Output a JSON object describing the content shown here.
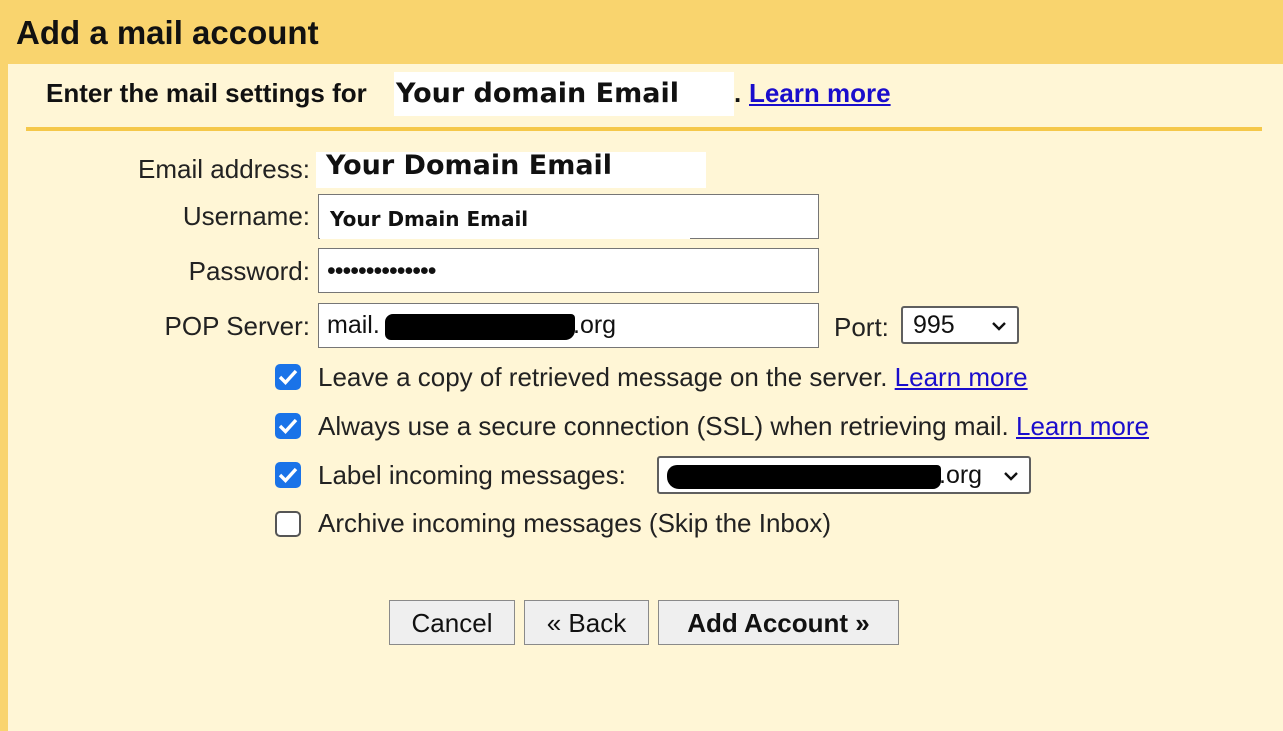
{
  "dialog": {
    "title": "Add a mail account"
  },
  "header": {
    "prefix": "Enter the mail settings for",
    "domain": "Your domain Email",
    "dot": ".",
    "learn_more": "Learn more"
  },
  "form": {
    "email_label": "Email address:",
    "email_value": "Your Domain Email",
    "username_label": "Username:",
    "username_value": "Your Dmain Email",
    "password_label": "Password:",
    "password_value": "••••••••••••••",
    "pop_label": "POP Server:",
    "pop_prefix": "mail.",
    "pop_suffix": ".org",
    "port_label": "Port:",
    "port_value": "995"
  },
  "options": [
    {
      "label": "Leave a copy of retrieved message on the server.",
      "link": "Learn more",
      "checked": true
    },
    {
      "label": "Always use a secure connection (SSL) when retrieving mail.",
      "link": "Learn more",
      "checked": true
    },
    {
      "label": "Label incoming messages:",
      "select_suffix": ".org",
      "checked": true
    },
    {
      "label": "Archive incoming messages (Skip the Inbox)",
      "checked": false
    }
  ],
  "buttons": {
    "cancel": "Cancel",
    "back": "« Back",
    "add": "Add Account »"
  },
  "colors": {
    "title_bg": "#f9d46e",
    "content_bg": "#fff6d6",
    "link": "#1a0dcc",
    "checkbox": "#1a73e8"
  }
}
